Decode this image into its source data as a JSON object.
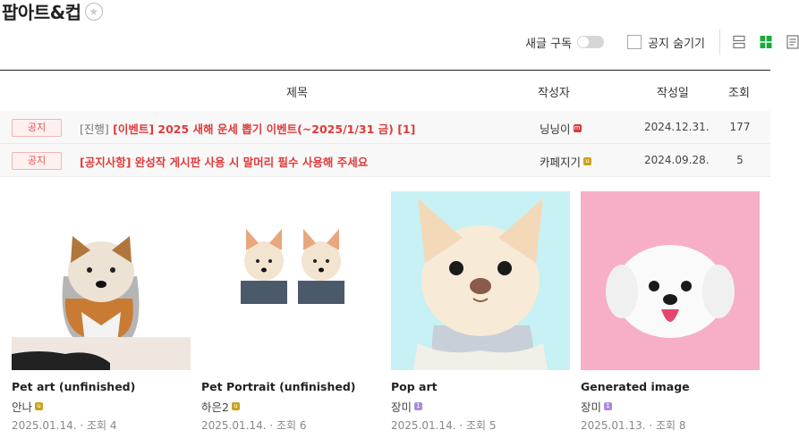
{
  "board": {
    "title": "팝아트&컵"
  },
  "toolbar": {
    "subscribe_label": "새글 구독",
    "hide_notice_label": "공지 숨기기"
  },
  "table": {
    "headers": {
      "subject": "제목",
      "author": "작성자",
      "date": "작성일",
      "views": "조회"
    },
    "notices": [
      {
        "badge": "공지",
        "tag": "[진행]",
        "subject": "[이벤트] 2025 새해 운세 뽑기 이벤트(~2025/1/31 금) [1]",
        "author": "닝닝이",
        "level_color": "#d93a3a",
        "date": "2024.12.31.",
        "views": "177"
      },
      {
        "badge": "공지",
        "tag": "",
        "subject": "[공지사항] 완성작 게시판 사용 시 말머리 필수 사용해 주세요",
        "author": "카페지기",
        "level_color": "#c9a21e",
        "date": "2024.09.28.",
        "views": "5"
      }
    ]
  },
  "cards": [
    {
      "title": "Pet art (unfinished)",
      "author": "안나",
      "level_color": "#c9a21e",
      "date": "2025.01.14.",
      "views": "· 조회 4"
    },
    {
      "title": "Pet Portrait (unfinished)",
      "author": "하은2",
      "level_color": "#c9a21e",
      "date": "2025.01.14.",
      "views": "· 조회 6"
    },
    {
      "title": "Pop art",
      "author": "장미",
      "level_color": "#a98be0",
      "date": "2025.01.14.",
      "views": "· 조회 5"
    },
    {
      "title": "Generated image",
      "author": "장미",
      "level_color": "#a98be0",
      "date": "2025.01.13.",
      "views": "· 조회 8"
    }
  ],
  "colors": {
    "accent_green": "#1aaa3c",
    "notice_red": "#e03a3a"
  }
}
